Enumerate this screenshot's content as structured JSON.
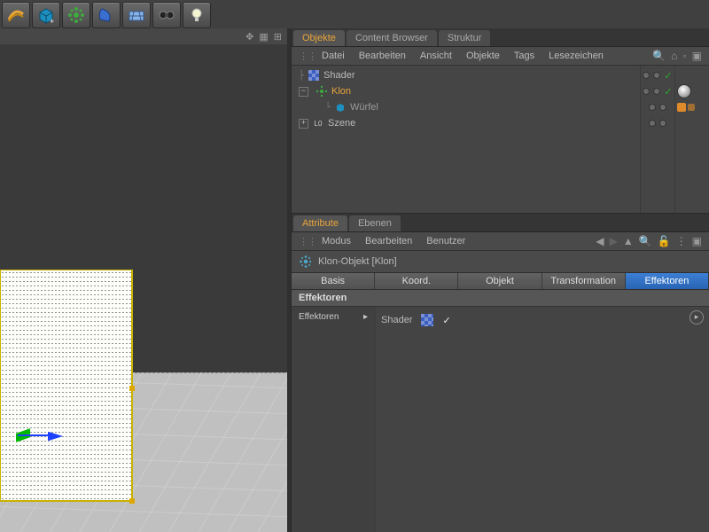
{
  "toolbar": {
    "icons": [
      "bend",
      "cube-plus",
      "cloner-green",
      "deformer",
      "floor",
      "camera",
      "light"
    ]
  },
  "viewport_header": {
    "icons": [
      "✥",
      "▦",
      "⊞"
    ]
  },
  "scene": {
    "selected_object": "Klon",
    "axis_visible": true,
    "grid_visible": true
  },
  "panels": {
    "objects": {
      "tabs": [
        {
          "label": "Objekte",
          "active": true
        },
        {
          "label": "Content Browser",
          "active": false
        },
        {
          "label": "Struktur",
          "active": false
        }
      ],
      "menu": [
        "Datei",
        "Bearbeiten",
        "Ansicht",
        "Objekte",
        "Tags",
        "Lesezeichen"
      ],
      "menu_icons": [
        "🔍",
        "⌂",
        "◦",
        "▣"
      ],
      "tree": [
        {
          "label": "Shader",
          "icon": "shader",
          "indent": 0,
          "selected": false,
          "tags": []
        },
        {
          "label": "Klon",
          "icon": "cloner",
          "indent": 1,
          "selected": true,
          "expandable": true,
          "tags": [
            "texture"
          ]
        },
        {
          "label": "Würfel",
          "icon": "cube",
          "indent": 2,
          "selected": false,
          "sub": true,
          "tags": [
            "orange"
          ]
        },
        {
          "label": "Szene",
          "icon": "take",
          "indent": 3,
          "selected": false,
          "expandable": true,
          "tags": []
        }
      ]
    },
    "attributes": {
      "tabs": [
        {
          "label": "Attribute",
          "active": true
        },
        {
          "label": "Ebenen",
          "active": false
        }
      ],
      "menu": [
        "Modus",
        "Bearbeiten",
        "Benutzer"
      ],
      "nav_icons": [
        "◀",
        "",
        "▲",
        "🔍",
        "🔓",
        "⋮",
        "▣"
      ],
      "object_title": "Klon-Objekt [Klon]",
      "object_icon": "cloner",
      "categories": [
        {
          "label": "Basis",
          "active": false
        },
        {
          "label": "Koord.",
          "active": false
        },
        {
          "label": "Objekt",
          "active": false
        },
        {
          "label": "Transformation",
          "active": false
        },
        {
          "label": "Effektoren",
          "active": true
        }
      ],
      "section": {
        "title": "Effektoren",
        "field_label": "Effektoren",
        "arrow": "▸",
        "items": [
          {
            "label": "Shader",
            "icon": "shader",
            "checked": true
          }
        ]
      }
    }
  }
}
